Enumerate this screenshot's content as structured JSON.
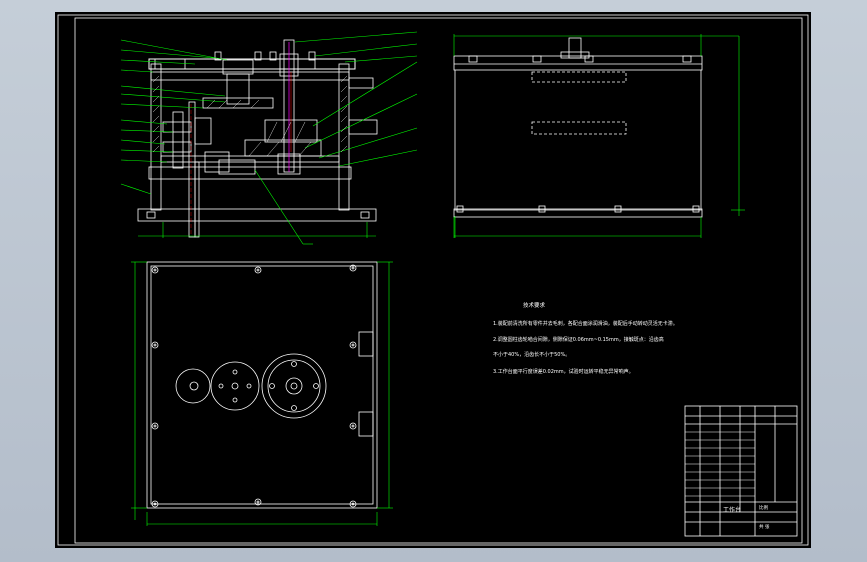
{
  "colors": {
    "background": "#000000",
    "outline": "#ffffff",
    "dimension": "#00ff00",
    "hidden_line": "#ff0000",
    "axis": "#ff00ff",
    "hatch": "#ffffff",
    "frame_surround": "#b9c3cf"
  },
  "notes": {
    "title": "技术要求",
    "items": [
      "1.装配前清洗所有零件并去毛刺，各配合面涂润滑油，装配后手动转动灵活无卡滞。",
      "2.调整圆柱齿轮啮合间隙，侧隙保证0.06mm~0.15mm，接触斑点：沿齿高",
      "  不小于40%，沿齿长不小于50%。",
      "3.工作台面平行度误差0.02mm，试验时运转平稳无异常响声。"
    ]
  },
  "title_block": {
    "drawing_name": "工作台",
    "scale_label": "比例",
    "sheet_label": "共 张"
  }
}
